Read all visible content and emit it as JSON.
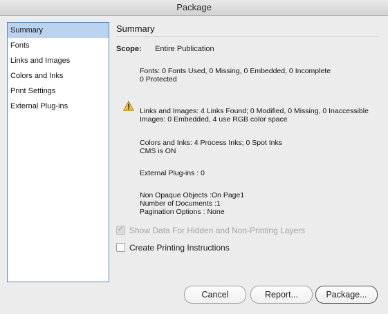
{
  "window": {
    "title": "Package"
  },
  "sidebar": {
    "items": [
      {
        "label": "Summary"
      },
      {
        "label": "Fonts"
      },
      {
        "label": "Links and Images"
      },
      {
        "label": "Colors and Inks"
      },
      {
        "label": "Print Settings"
      },
      {
        "label": "External Plug-ins"
      }
    ]
  },
  "summary": {
    "title": "Summary",
    "scope_label": "Scope:",
    "scope_value": "Entire Publication",
    "fonts_line1": "Fonts: 0 Fonts Used, 0 Missing, 0 Embedded, 0 Incomplete",
    "fonts_line2": "0 Protected",
    "links_line1": "Links and Images: 4 Links Found; 0 Modified, 0 Missing, 0 Inaccessible",
    "links_line2": "Images: 0 Embedded, 4 use RGB color space",
    "colors_line1": "Colors and Inks: 4 Process Inks; 0 Spot Inks",
    "colors_line2": "CMS is ON",
    "plugins_line": "External Plug-ins : 0",
    "nonopaque_line": "Non Opaque Objects :On Page1",
    "documents_line": "Number of Documents :1",
    "pagination_line": "Pagination Options : None",
    "warning_icon": "warning-triangle-icon"
  },
  "options": {
    "show_hidden_label": "Show Data For Hidden and Non-Printing Layers",
    "show_hidden_checked": true,
    "show_hidden_enabled": false,
    "create_instructions_label": "Create Printing Instructions",
    "create_instructions_checked": false
  },
  "buttons": {
    "cancel": "Cancel",
    "report": "Report...",
    "package": "Package..."
  },
  "colors": {
    "selection": "#bcd3f0",
    "sidebar_border": "#5a86b8",
    "warning": "#f2c230"
  }
}
